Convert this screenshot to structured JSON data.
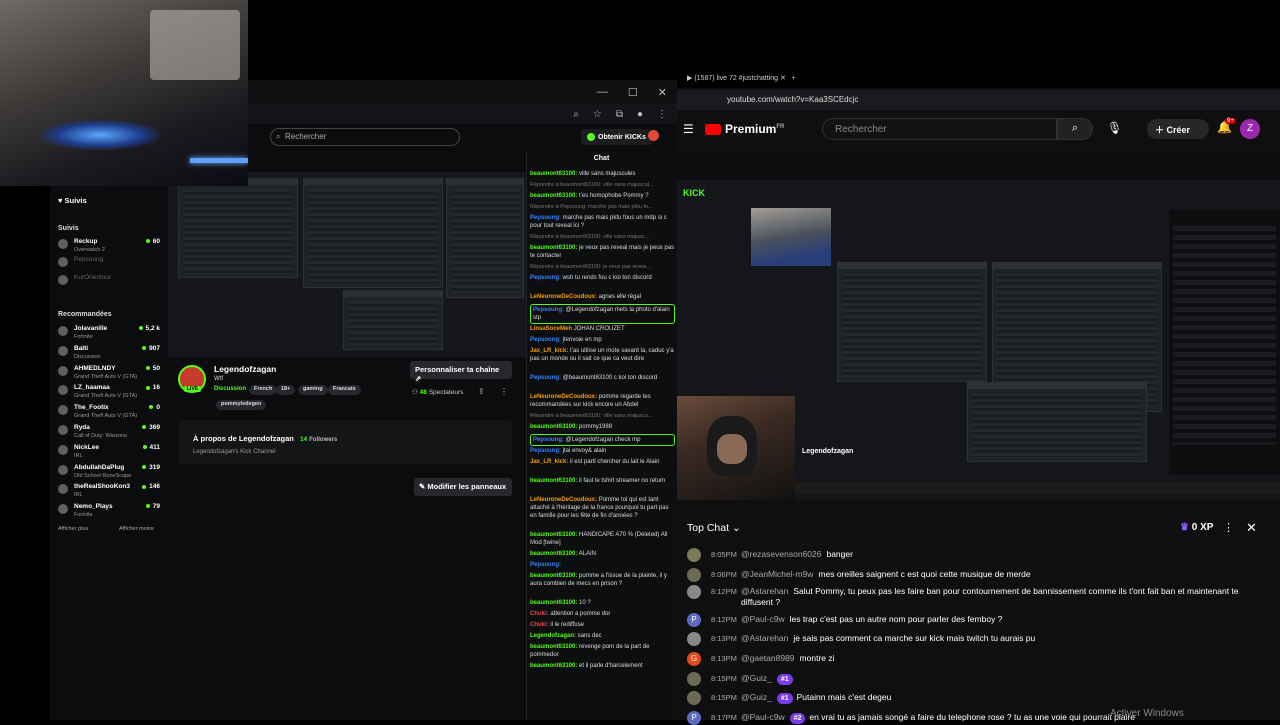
{
  "left": {
    "search_placeholder": "Rechercher",
    "obtain_label": "Obtenir KICKs",
    "sidebar": {
      "followed_label": "Suivis",
      "followed_header": "Suivis",
      "followed": [
        {
          "name": "Reckup",
          "game": "Overwatch 2",
          "count": "60",
          "online": true
        },
        {
          "name": "Pepsoung",
          "game": "",
          "count": "",
          "online": false
        },
        {
          "name": "KurOrientour",
          "game": "",
          "count": "",
          "online": false
        }
      ],
      "recommended_header": "Recommandées",
      "recommended": [
        {
          "name": "Jolavanille",
          "game": "Fortnite",
          "count": "5,2 k"
        },
        {
          "name": "Balti",
          "game": "Discussion",
          "count": "907"
        },
        {
          "name": "AHMEDLNDY",
          "game": "Grand Theft Auto V (GTA)",
          "count": "50"
        },
        {
          "name": "LZ_haamaa",
          "game": "Grand Theft Auto V (GTA)",
          "count": "16"
        },
        {
          "name": "The_Footix",
          "game": "Grand Theft Auto V (GTA)",
          "count": "0"
        },
        {
          "name": "Ryda",
          "game": "Call of Duty: Warzone",
          "count": "369"
        },
        {
          "name": "NickLee",
          "game": "IRL",
          "count": "411"
        },
        {
          "name": "AbdullahDaPlug",
          "game": "Old School RuneScape",
          "count": "319"
        },
        {
          "name": "theRealShooKon3",
          "game": "IRL",
          "count": "146"
        },
        {
          "name": "Nemo_Plays",
          "game": "Fortnite",
          "count": "79"
        }
      ],
      "show_more": "Afficher plus",
      "show_less": "Afficher moins"
    },
    "channel": {
      "name": "Legendofzagan",
      "title": "Wtf",
      "live": "LIVE",
      "category": "Discussion",
      "tags": [
        "French",
        "18+",
        "gaming",
        "Francais"
      ],
      "tag2": "pommyledegen",
      "personalize": "Personnaliser ta chaîne",
      "viewers_count": "48",
      "viewers_label": "Spectateurs",
      "about_title": "À propos de Legendofzagan",
      "followers_count": "14",
      "followers_label": "Followers",
      "about_desc": "Legendofzagan's Kick Channel",
      "edit_panels": "Modifier les panneaux"
    },
    "chat": {
      "header": "Chat",
      "messages": [
        {
          "user": "beaumont63100:",
          "text": "ville sans majuscules",
          "style": "u"
        },
        {
          "user": "Répondre à beaumont63100:",
          "text": "ville sans majuscul...",
          "style": "rep"
        },
        {
          "user": "beaumont63100:",
          "text": "t'es homophobe Pommy ?",
          "style": "u"
        },
        {
          "user": "Répondre à Pepsoung:",
          "text": "marche pas mais pktu fo...",
          "style": "rep"
        },
        {
          "user": "Pepsoung:",
          "text": "marche pas mais pktu fous un mdp si c pour tout reveal ici ?",
          "style": "u3"
        },
        {
          "user": "Répondre à beaumont63100:",
          "text": "ville sans majusc...",
          "style": "rep"
        },
        {
          "user": "beaumont63100:",
          "text": "je veux pas reveal mais je peux pas te contacter",
          "style": "u"
        },
        {
          "user": "Répondre à beaumont63100:",
          "text": "je veux pas revea...",
          "style": "rep"
        },
        {
          "user": "Pepsoung:",
          "text": "wsh tu rends fou c koi ton discord",
          "style": "u3"
        },
        {
          "user": "LeNeuroneDeCoudoux:",
          "text": "agnes elle régal",
          "style": "u2"
        },
        {
          "user": "Pepsoung:",
          "text": "@Legendofzagan mets la photo d'alain stp",
          "style": "u3",
          "hl": true
        },
        {
          "user": "LinsaSoceMeh",
          "text": "JOHAN CROUZET",
          "style": "u2"
        },
        {
          "user": "Pepsoung:",
          "text": "jtenvoie en mp",
          "style": "u3"
        },
        {
          "user": "Jax_LR_kick:",
          "text": "t'as utilise un mote savant la, caduc y'a pas un monde ou il sait ce que ca veut dire",
          "style": "u2"
        },
        {
          "user": "Pepsoung:",
          "text": "@beaumont63100 c koi ton discord",
          "style": "u3"
        },
        {
          "user": "LeNeuroneDeCoudoux:",
          "text": "pomme regarde tes recommandées sur kick encore un Abdel",
          "style": "u2"
        },
        {
          "user": "Répondre à beaumont63100:",
          "text": "ville sans majuscu...",
          "style": "rep"
        },
        {
          "user": "beaumont63100:",
          "text": "pommy1988",
          "style": "u"
        },
        {
          "user": "Pepsoung:",
          "text": "@Legendofzagan check mp",
          "style": "u3",
          "hl": true
        },
        {
          "user": "Pepsoung:",
          "text": "jtai envoy& alain",
          "style": "u3"
        },
        {
          "user": "Jax_LR_kick:",
          "text": "il est parti chercher du lait le Alain",
          "style": "u2"
        },
        {
          "user": "beaumont63100:",
          "text": "il faut le tshirt streamer no return",
          "style": "u"
        },
        {
          "user": "LeNeuroneDeCoudoux:",
          "text": "Pomme toi qui est tant attaché à l'héritage de la france pourquoi tu part pas en famille pour les fête de fin d'années ?",
          "style": "u2"
        },
        {
          "user": "beaumont63100:",
          "text": "HANDICAPE A70 % (Deleted) All Mod [twine]",
          "style": "u"
        },
        {
          "user": "beaumont63100:",
          "text": "ALAIN",
          "style": "u"
        },
        {
          "user": "Pepsoung:",
          "text": "",
          "style": "u3"
        },
        {
          "user": "beaumont63100:",
          "text": "pomme a l'issue de la plainte, il y aura combien de mecs en prison ?",
          "style": "u"
        },
        {
          "user": "beaumont63100:",
          "text": "10 ?",
          "style": "u"
        },
        {
          "user": "Chuki:",
          "text": "attention a pomme dor",
          "style": "u4"
        },
        {
          "user": "Chuki:",
          "text": "il le rediffuse",
          "style": "u4"
        },
        {
          "user": "Legendofzagan:",
          "text": "sans dec",
          "style": "u"
        },
        {
          "user": "beaumont63100:",
          "text": "revenge porn de la part de pommedor",
          "style": "u"
        },
        {
          "user": "beaumont63100:",
          "text": "et il parle d'harcelement",
          "style": "u"
        }
      ]
    }
  },
  "right": {
    "tab_title": "(1587) live 72 #justchatting",
    "url": "youtube.com/watch?v=Kaa3SCEdcjc",
    "yt_brand": "Premium",
    "yt_region": "FR",
    "search_placeholder": "Rechercher",
    "create_label": "Créer",
    "notif_badge": "9+",
    "avatar_letter": "Z",
    "inner_kick_logo": "KICK",
    "inner_streamer_name": "Legendofzagan",
    "chat": {
      "title": "Top Chat",
      "xp": "0 XP",
      "messages": [
        {
          "time": "8:05PM",
          "author": "@rezasevenson6026",
          "text": "banger",
          "avatar_color": "#7a7a5a",
          "avatar_letter": "",
          "badge": ""
        },
        {
          "time": "8:06PM",
          "author": "@JeanMichel-m9w",
          "text": "mes oreilles saignent c est quoi cette musique de merde",
          "avatar_color": "#6b6b55",
          "avatar_letter": "",
          "badge": ""
        },
        {
          "time": "8:12PM",
          "author": "@Astarehan",
          "text": "Salut Pommy, tu peux pas les faire ban pour contournement de bannissement comme ils t'ont fait ban et maintenant te diffusent ?",
          "avatar_color": "#888888",
          "avatar_letter": "",
          "badge": ""
        },
        {
          "time": "8:12PM",
          "author": "@Paul-c9w",
          "text": "les trap c'est pas un autre nom pour parler des femboy ?",
          "avatar_color": "#5c6bc0",
          "avatar_letter": "P",
          "badge": ""
        },
        {
          "time": "8:13PM",
          "author": "@Astarehan",
          "text": "je sais pas comment ca marche sur kick mais twitch tu aurais pu",
          "avatar_color": "#888888",
          "avatar_letter": "",
          "badge": ""
        },
        {
          "time": "8:13PM",
          "author": "@gaetan8989",
          "text": "montre zi",
          "avatar_color": "#e64a19",
          "avatar_letter": "G",
          "badge": ""
        },
        {
          "time": "8:15PM",
          "author": "@Guiz_",
          "text": "",
          "avatar_color": "#6b6b55",
          "avatar_letter": "",
          "badge": "#1"
        },
        {
          "time": "8:15PM",
          "author": "@Guiz_",
          "text": "Putainn mais c'est degeu",
          "avatar_color": "#6b6b55",
          "avatar_letter": "",
          "badge": "#1"
        },
        {
          "time": "8:17PM",
          "author": "@Paul-c9w",
          "text": "en vrai tu as jamais songé a faire du telephone rose ? tu as une voie qui pourrait plaire",
          "avatar_color": "#5c6bc0",
          "avatar_letter": "P",
          "badge": "#2"
        }
      ]
    }
  },
  "os": {
    "activate": "Activer Windows"
  }
}
